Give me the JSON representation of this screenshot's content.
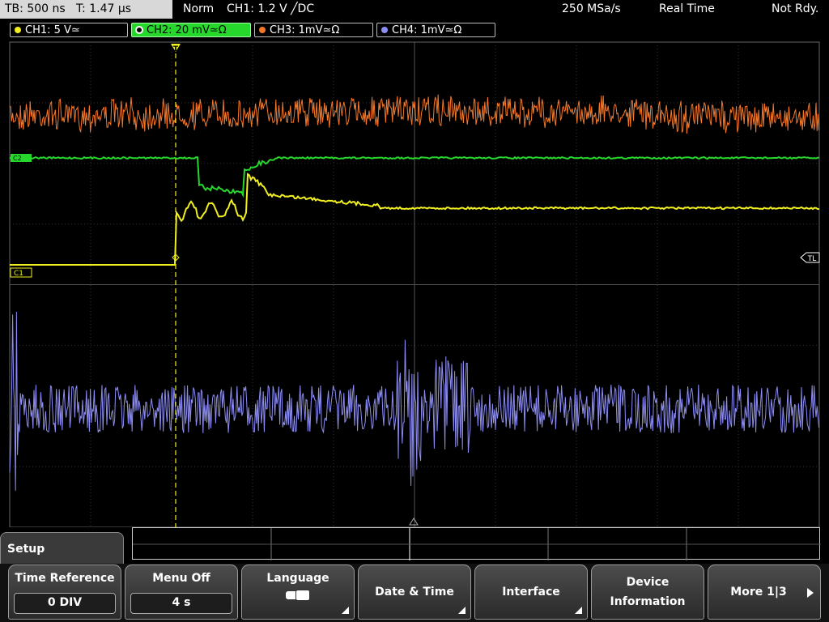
{
  "status_bar": {
    "timebase": "TB: 500 ns",
    "trigger_time": "T: 1.47 µs",
    "trigger_mode": "Norm",
    "trigger_source": "CH1: 1.2 V ╱DC",
    "sample_rate": "250 MSa/s",
    "acq_mode": "Real Time",
    "run_state": "Not Rdy."
  },
  "channels": [
    {
      "label": "CH1: 5 V≃",
      "color": "#f2ef1e",
      "active": false
    },
    {
      "label": "CH2: 20 mV≃Ω",
      "color": "#27d82c",
      "active": true
    },
    {
      "label": "CH3: 1mV≃Ω",
      "color": "#f5782a",
      "active": false
    },
    {
      "label": "CH4: 1mV≃Ω",
      "color": "#8d8df5",
      "active": false
    }
  ],
  "markers": {
    "trigger_marker": "T",
    "trigger_level": "TL",
    "ch1_marker": "C1",
    "ch2_marker": "C2"
  },
  "menu": {
    "title": "Setup",
    "softkeys": [
      {
        "label": "Time Reference",
        "value": "0 DIV"
      },
      {
        "label": "Menu Off",
        "value": "4 s"
      },
      {
        "label": "Language",
        "icon": "speech-bubbles-icon"
      },
      {
        "label": "Date & Time"
      },
      {
        "label": "Interface"
      },
      {
        "label_line1": "Device",
        "label_line2": "Information"
      },
      {
        "label": "More 1|3"
      }
    ]
  }
}
